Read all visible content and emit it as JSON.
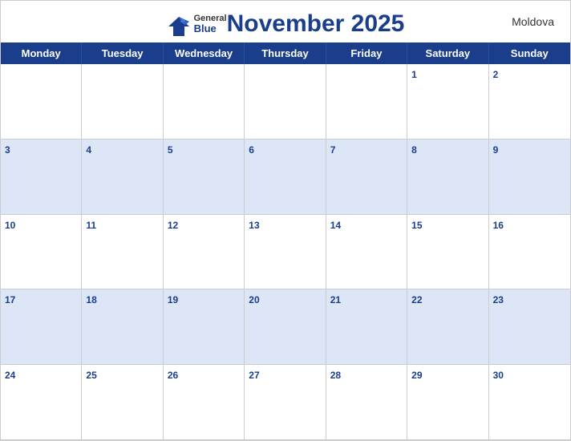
{
  "header": {
    "title": "November 2025",
    "country": "Moldova",
    "logo": {
      "general": "General",
      "blue": "Blue"
    }
  },
  "days": [
    "Monday",
    "Tuesday",
    "Wednesday",
    "Thursday",
    "Friday",
    "Saturday",
    "Sunday"
  ],
  "weeks": [
    [
      null,
      null,
      null,
      null,
      null,
      1,
      2
    ],
    [
      3,
      4,
      5,
      6,
      7,
      8,
      9
    ],
    [
      10,
      11,
      12,
      13,
      14,
      15,
      16
    ],
    [
      17,
      18,
      19,
      20,
      21,
      22,
      23
    ],
    [
      24,
      25,
      26,
      27,
      28,
      29,
      30
    ]
  ]
}
